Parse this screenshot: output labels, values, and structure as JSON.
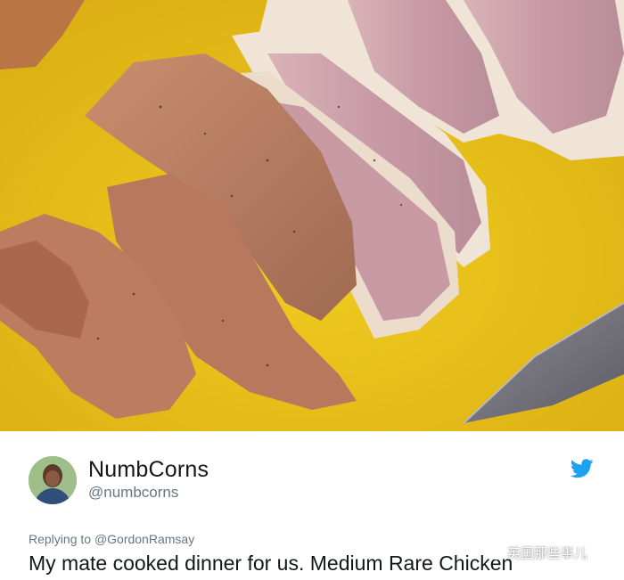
{
  "tweet": {
    "display_name": "NumbCorns",
    "handle": "@numbcorns",
    "replying_prefix": "Replying to",
    "replying_to": "@GordonRamsay",
    "text": "My mate cooked dinner for us. Medium Rare Chicken"
  },
  "icons": {
    "platform": "twitter-bird-icon",
    "watermark": "wechat-logo-icon"
  },
  "watermark": {
    "text": "英国那些事儿"
  },
  "colors": {
    "twitter_blue": "#1da1f2",
    "cutting_board": "#e8c21a",
    "name": "#14171a",
    "secondary": "#657786"
  }
}
